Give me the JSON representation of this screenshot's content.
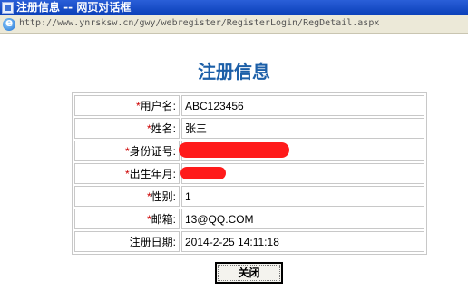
{
  "window": {
    "title": "注册信息 -- 网页对话框"
  },
  "address": {
    "url": "http://www.ynrsksw.cn/gwy/webregister/RegisterLogin/RegDetail.aspx"
  },
  "page": {
    "heading": "注册信息"
  },
  "fields": [
    {
      "required": "*",
      "label": "用户名:",
      "value": "ABC123456"
    },
    {
      "required": "*",
      "label": "姓名:",
      "value": "张三"
    },
    {
      "required": "*",
      "label": "身份证号:",
      "value": ""
    },
    {
      "required": "*",
      "label": "出生年月:",
      "value": ""
    },
    {
      "required": "*",
      "label": "性别:",
      "value": "1"
    },
    {
      "required": "*",
      "label": "邮箱:",
      "value": "13@QQ.COM"
    },
    {
      "required": "",
      "label": "注册日期:",
      "value": "2014-2-25 14:11:18"
    }
  ],
  "buttons": {
    "close": "关闭"
  },
  "icons": {
    "window": "window-icon",
    "browser": "ie-icon"
  },
  "colors": {
    "heading": "#1c5fa8",
    "required": "#cc0000",
    "redaction": "#ff1b1b"
  }
}
